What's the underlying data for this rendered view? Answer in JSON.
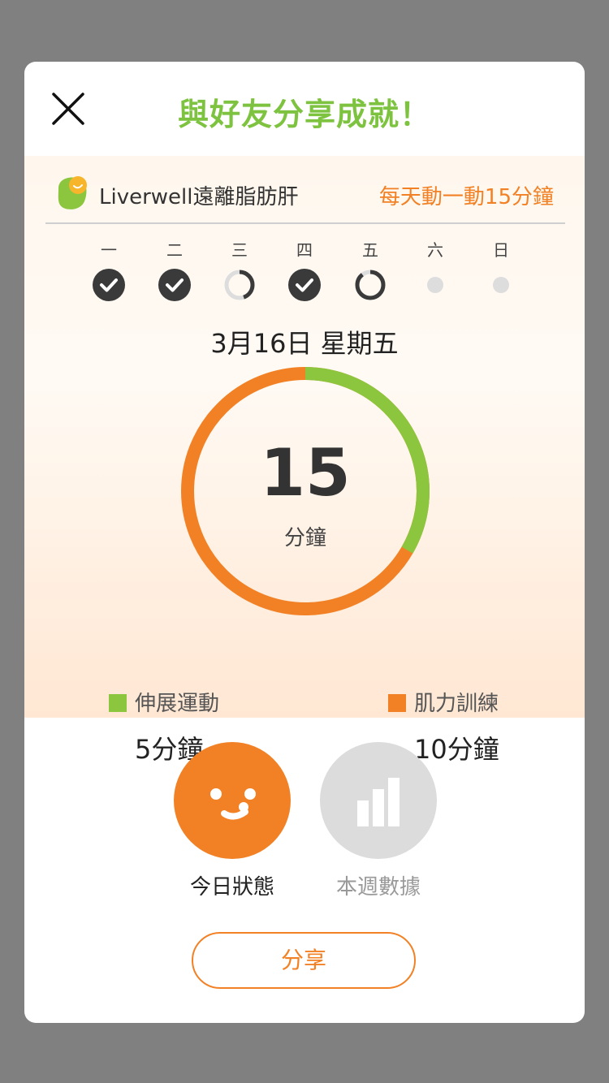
{
  "header": {
    "title": "與好友分享成就！"
  },
  "brand": {
    "name": "Liverwell遠離脂肪肝",
    "slogan": "每天動一動15分鐘"
  },
  "week": [
    {
      "label": "一",
      "status": "done"
    },
    {
      "label": "二",
      "status": "done"
    },
    {
      "label": "三",
      "status": "partial",
      "progress": 0.45
    },
    {
      "label": "四",
      "status": "done"
    },
    {
      "label": "五",
      "status": "partial",
      "progress": 0.9
    },
    {
      "label": "六",
      "status": "empty"
    },
    {
      "label": "日",
      "status": "empty"
    }
  ],
  "summary": {
    "date": "3月16日 星期五",
    "total": "15",
    "total_unit": "分鐘"
  },
  "breakdown": [
    {
      "label": "伸展運動",
      "value": "5分鐘",
      "minutes": 5,
      "color": "#8cc63f"
    },
    {
      "label": "肌力訓練",
      "value": "10分鐘",
      "minutes": 10,
      "color": "#f28125"
    }
  ],
  "tabs": [
    {
      "label": "今日狀態",
      "icon": "smiley-face-icon",
      "active": true
    },
    {
      "label": "本週數據",
      "icon": "bar-chart-icon",
      "active": false
    }
  ],
  "share_label": "分享",
  "colors": {
    "accent_orange": "#f28125",
    "accent_green": "#8cc63f",
    "title_green": "#7dc340",
    "inactive_gray": "#dcdcdc"
  }
}
